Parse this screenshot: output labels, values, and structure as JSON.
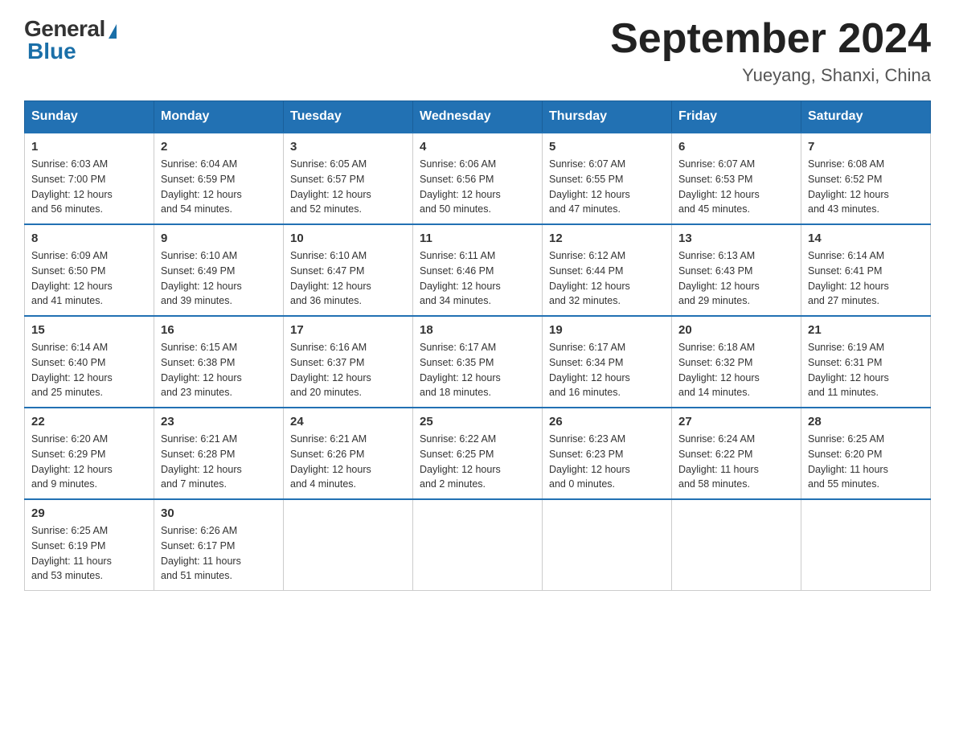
{
  "header": {
    "logo_general": "General",
    "logo_blue": "Blue",
    "title": "September 2024",
    "subtitle": "Yueyang, Shanxi, China"
  },
  "weekdays": [
    "Sunday",
    "Monday",
    "Tuesday",
    "Wednesday",
    "Thursday",
    "Friday",
    "Saturday"
  ],
  "weeks": [
    [
      {
        "day": "1",
        "info": "Sunrise: 6:03 AM\nSunset: 7:00 PM\nDaylight: 12 hours\nand 56 minutes."
      },
      {
        "day": "2",
        "info": "Sunrise: 6:04 AM\nSunset: 6:59 PM\nDaylight: 12 hours\nand 54 minutes."
      },
      {
        "day": "3",
        "info": "Sunrise: 6:05 AM\nSunset: 6:57 PM\nDaylight: 12 hours\nand 52 minutes."
      },
      {
        "day": "4",
        "info": "Sunrise: 6:06 AM\nSunset: 6:56 PM\nDaylight: 12 hours\nand 50 minutes."
      },
      {
        "day": "5",
        "info": "Sunrise: 6:07 AM\nSunset: 6:55 PM\nDaylight: 12 hours\nand 47 minutes."
      },
      {
        "day": "6",
        "info": "Sunrise: 6:07 AM\nSunset: 6:53 PM\nDaylight: 12 hours\nand 45 minutes."
      },
      {
        "day": "7",
        "info": "Sunrise: 6:08 AM\nSunset: 6:52 PM\nDaylight: 12 hours\nand 43 minutes."
      }
    ],
    [
      {
        "day": "8",
        "info": "Sunrise: 6:09 AM\nSunset: 6:50 PM\nDaylight: 12 hours\nand 41 minutes."
      },
      {
        "day": "9",
        "info": "Sunrise: 6:10 AM\nSunset: 6:49 PM\nDaylight: 12 hours\nand 39 minutes."
      },
      {
        "day": "10",
        "info": "Sunrise: 6:10 AM\nSunset: 6:47 PM\nDaylight: 12 hours\nand 36 minutes."
      },
      {
        "day": "11",
        "info": "Sunrise: 6:11 AM\nSunset: 6:46 PM\nDaylight: 12 hours\nand 34 minutes."
      },
      {
        "day": "12",
        "info": "Sunrise: 6:12 AM\nSunset: 6:44 PM\nDaylight: 12 hours\nand 32 minutes."
      },
      {
        "day": "13",
        "info": "Sunrise: 6:13 AM\nSunset: 6:43 PM\nDaylight: 12 hours\nand 29 minutes."
      },
      {
        "day": "14",
        "info": "Sunrise: 6:14 AM\nSunset: 6:41 PM\nDaylight: 12 hours\nand 27 minutes."
      }
    ],
    [
      {
        "day": "15",
        "info": "Sunrise: 6:14 AM\nSunset: 6:40 PM\nDaylight: 12 hours\nand 25 minutes."
      },
      {
        "day": "16",
        "info": "Sunrise: 6:15 AM\nSunset: 6:38 PM\nDaylight: 12 hours\nand 23 minutes."
      },
      {
        "day": "17",
        "info": "Sunrise: 6:16 AM\nSunset: 6:37 PM\nDaylight: 12 hours\nand 20 minutes."
      },
      {
        "day": "18",
        "info": "Sunrise: 6:17 AM\nSunset: 6:35 PM\nDaylight: 12 hours\nand 18 minutes."
      },
      {
        "day": "19",
        "info": "Sunrise: 6:17 AM\nSunset: 6:34 PM\nDaylight: 12 hours\nand 16 minutes."
      },
      {
        "day": "20",
        "info": "Sunrise: 6:18 AM\nSunset: 6:32 PM\nDaylight: 12 hours\nand 14 minutes."
      },
      {
        "day": "21",
        "info": "Sunrise: 6:19 AM\nSunset: 6:31 PM\nDaylight: 12 hours\nand 11 minutes."
      }
    ],
    [
      {
        "day": "22",
        "info": "Sunrise: 6:20 AM\nSunset: 6:29 PM\nDaylight: 12 hours\nand 9 minutes."
      },
      {
        "day": "23",
        "info": "Sunrise: 6:21 AM\nSunset: 6:28 PM\nDaylight: 12 hours\nand 7 minutes."
      },
      {
        "day": "24",
        "info": "Sunrise: 6:21 AM\nSunset: 6:26 PM\nDaylight: 12 hours\nand 4 minutes."
      },
      {
        "day": "25",
        "info": "Sunrise: 6:22 AM\nSunset: 6:25 PM\nDaylight: 12 hours\nand 2 minutes."
      },
      {
        "day": "26",
        "info": "Sunrise: 6:23 AM\nSunset: 6:23 PM\nDaylight: 12 hours\nand 0 minutes."
      },
      {
        "day": "27",
        "info": "Sunrise: 6:24 AM\nSunset: 6:22 PM\nDaylight: 11 hours\nand 58 minutes."
      },
      {
        "day": "28",
        "info": "Sunrise: 6:25 AM\nSunset: 6:20 PM\nDaylight: 11 hours\nand 55 minutes."
      }
    ],
    [
      {
        "day": "29",
        "info": "Sunrise: 6:25 AM\nSunset: 6:19 PM\nDaylight: 11 hours\nand 53 minutes."
      },
      {
        "day": "30",
        "info": "Sunrise: 6:26 AM\nSunset: 6:17 PM\nDaylight: 11 hours\nand 51 minutes."
      },
      {
        "day": "",
        "info": ""
      },
      {
        "day": "",
        "info": ""
      },
      {
        "day": "",
        "info": ""
      },
      {
        "day": "",
        "info": ""
      },
      {
        "day": "",
        "info": ""
      }
    ]
  ]
}
